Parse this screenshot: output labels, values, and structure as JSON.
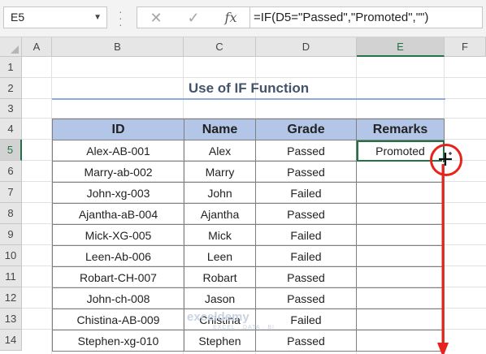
{
  "name_box": {
    "value": "E5",
    "dropdown_icon": "chevron-down-icon"
  },
  "formula_bar": {
    "cancel_icon": "✕",
    "enter_icon": "✓",
    "function_icon": "fx",
    "formula": "=IF(D5=\"Passed\",\"Promoted\",\"\")"
  },
  "columns": [
    "A",
    "B",
    "C",
    "D",
    "E",
    "F"
  ],
  "rows": [
    "1",
    "2",
    "3",
    "4",
    "5",
    "6",
    "7",
    "8",
    "9",
    "10",
    "11",
    "12",
    "13",
    "14"
  ],
  "active_cell": {
    "column": "E",
    "row": "5"
  },
  "sheet_title": "Use of IF Function",
  "table": {
    "headers": [
      "ID",
      "Name",
      "Grade",
      "Remarks"
    ],
    "rows": [
      [
        "Alex-AB-001",
        "Alex",
        "Passed",
        "Promoted"
      ],
      [
        "Marry-ab-002",
        "Marry",
        "Passed",
        ""
      ],
      [
        "John-xg-003",
        "John",
        "Failed",
        ""
      ],
      [
        "Ajantha-aB-004",
        "Ajantha",
        "Passed",
        ""
      ],
      [
        "Mick-XG-005",
        "Mick",
        "Failed",
        ""
      ],
      [
        "Leen-Ab-006",
        "Leen",
        "Failed",
        ""
      ],
      [
        "Robart-CH-007",
        "Robart",
        "Passed",
        ""
      ],
      [
        "John-ch-008",
        "Jason",
        "Passed",
        ""
      ],
      [
        "Chistina-AB-009",
        "Chistina",
        "Failed",
        ""
      ],
      [
        "Stephen-xg-010",
        "Stephen",
        "Passed",
        ""
      ]
    ]
  },
  "watermark": {
    "name": "exceldemy",
    "tagline": "EXCEL · DATA · BI"
  },
  "colors": {
    "accent": "#217346",
    "header_fill": "#b4c6e7",
    "title": "#44546a",
    "annotation": "#e8231c"
  }
}
